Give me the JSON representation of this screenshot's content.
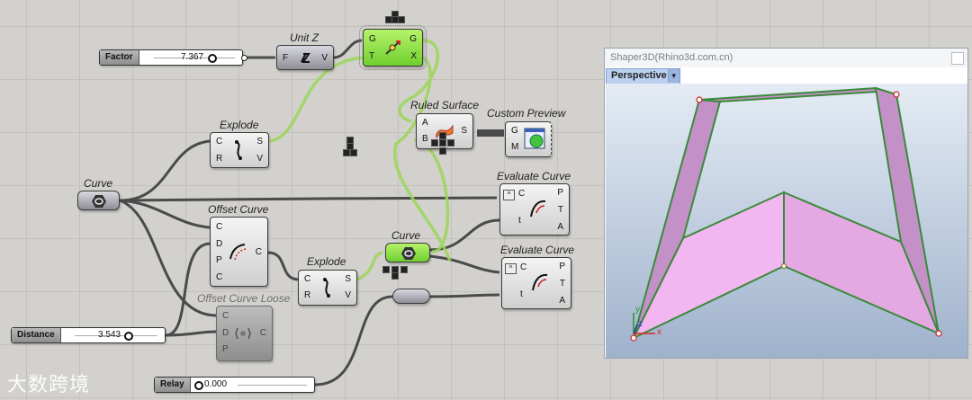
{
  "colors": {
    "canvas": "#d3d1cd",
    "wire": "#4a4a4a",
    "wire_selected": "#7ccc35",
    "node_green": "#86d83f"
  },
  "sliders": {
    "factor": {
      "label": "Factor",
      "value": "7.367"
    },
    "distance": {
      "label": "Distance",
      "value": "3.543"
    },
    "relay": {
      "label": "Relay",
      "value": "0.000"
    }
  },
  "components": {
    "unitz": {
      "title": "Unit Z",
      "inputs": [
        "F"
      ],
      "outputs": [
        "V"
      ]
    },
    "move": {
      "inputs": [
        "G",
        "T"
      ],
      "outputs": [
        "G",
        "X"
      ]
    },
    "explode1": {
      "title": "Explode",
      "inputs": [
        "C",
        "R"
      ],
      "outputs": [
        "S",
        "V"
      ]
    },
    "curve_param": {
      "title": "Curve"
    },
    "ruled": {
      "title": "Ruled Surface",
      "inputs": [
        "A",
        "B"
      ],
      "outputs": [
        "S"
      ]
    },
    "custom_preview": {
      "title": "Custom Preview",
      "inputs": [
        "G",
        "M"
      ]
    },
    "offset": {
      "title": "Offset Curve",
      "inputs": [
        "C",
        "D",
        "P",
        "C"
      ],
      "outputs": [
        "C"
      ]
    },
    "offset_loose": {
      "title": "Offset Curve Loose",
      "inputs": [
        "C",
        "D",
        "P"
      ],
      "outputs": [
        "C"
      ]
    },
    "explode2": {
      "title": "Explode",
      "inputs": [
        "C",
        "R"
      ],
      "outputs": [
        "S",
        "V"
      ]
    },
    "curve2": {
      "title": "Curve"
    },
    "eval1": {
      "title": "Evaluate Curve",
      "inputs": [
        "C",
        "t"
      ],
      "outputs": [
        "P",
        "T",
        "A"
      ]
    },
    "eval2": {
      "title": "Evaluate Curve",
      "inputs": [
        "C",
        "t"
      ],
      "outputs": [
        "P",
        "T",
        "A"
      ]
    }
  },
  "viewport": {
    "window_title": "Shaper3D(Rhino3d.com.cn)",
    "view_name": "Perspective",
    "axes": {
      "x": "x",
      "y": "y",
      "z": "z"
    }
  },
  "watermark": "大数跨境"
}
